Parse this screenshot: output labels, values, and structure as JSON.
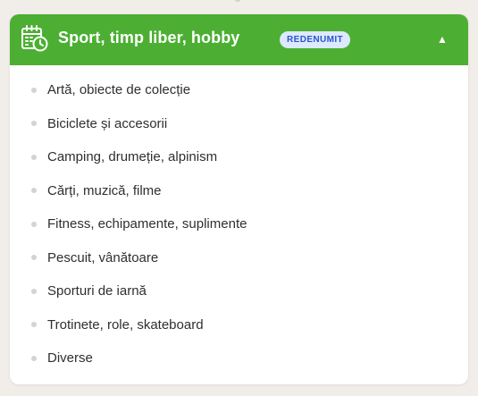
{
  "category": {
    "title": "Sport, timp liber, hobby",
    "badge": "REDENUMIT",
    "toggle_glyph": "▲",
    "icon": "calendar-clock-icon",
    "colors": {
      "header_bg": "#4caf33",
      "badge_bg": "#dce9ff",
      "badge_text": "#2d56c9",
      "page_bg": "#f1ede9"
    }
  },
  "subcategories": [
    {
      "label": "Artă, obiecte de colecție"
    },
    {
      "label": "Biciclete și accesorii"
    },
    {
      "label": "Camping, drumeție, alpinism"
    },
    {
      "label": "Cărți, muzică, filme"
    },
    {
      "label": "Fitness, echipamente, suplimente"
    },
    {
      "label": "Pescuit, vânătoare"
    },
    {
      "label": "Sporturi de iarnă"
    },
    {
      "label": "Trotinete, role, skateboard"
    },
    {
      "label": "Diverse"
    }
  ]
}
